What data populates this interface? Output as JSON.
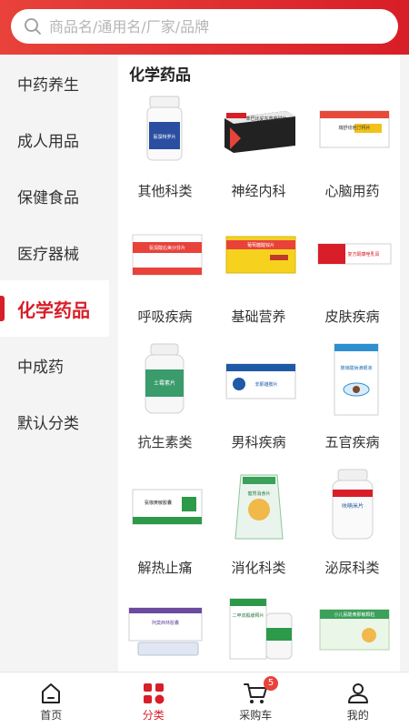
{
  "search": {
    "placeholder": "商品名/通用名/厂家/品牌"
  },
  "sidebar": {
    "items": [
      {
        "label": "中药养生"
      },
      {
        "label": "成人用品"
      },
      {
        "label": "保健食品"
      },
      {
        "label": "医疗器械"
      },
      {
        "label": "化学药品",
        "active": true
      },
      {
        "label": "中成药"
      },
      {
        "label": "默认分类"
      }
    ]
  },
  "section": {
    "title": "化学药品"
  },
  "categories": [
    {
      "label": "其他科类",
      "icon": "white-pill-bottle-icon"
    },
    {
      "label": "神经内科",
      "icon": "medicine-box-icon"
    },
    {
      "label": "心脑用药",
      "icon": "medicine-box-icon"
    },
    {
      "label": "呼吸疾病",
      "icon": "medicine-box-icon"
    },
    {
      "label": "基础营养",
      "icon": "medicine-box-icon"
    },
    {
      "label": "皮肤疾病",
      "icon": "medicine-box-icon"
    },
    {
      "label": "抗生素类",
      "icon": "pill-bottle-icon"
    },
    {
      "label": "男科疾病",
      "icon": "medicine-box-icon"
    },
    {
      "label": "五官疾病",
      "icon": "eye-drops-box-icon"
    },
    {
      "label": "解热止痛",
      "icon": "medicine-box-icon"
    },
    {
      "label": "消化科类",
      "icon": "medicine-pouch-icon"
    },
    {
      "label": "泌尿科类",
      "icon": "pill-bottle-icon"
    },
    {
      "label": "",
      "icon": "medicine-box-icon"
    },
    {
      "label": "",
      "icon": "medicine-box-icon"
    },
    {
      "label": "",
      "icon": "medicine-box-icon"
    }
  ],
  "thumb_text": {
    "t1": "氨溴特罗片",
    "t2": "苯巴比妥东莨菪碱片",
    "t3": "瑞舒伐他汀钙片",
    "t4": "氨溴酸右美沙芬片",
    "t5": "葡萄糖酸锌片",
    "t6": "复方酮康唑乳膏",
    "t7": "土霉素片",
    "t8": "非那雄胺片",
    "t9": "玻璃酸钠滴眼液",
    "t10": "氨咖黄敏胶囊",
    "t11": "健胃消食片",
    "t12": "呋喃米片",
    "t13": "阿莫西林胶囊",
    "t14": "二甲双胍缓释片",
    "t15": "小儿氨酚黄那敏颗粒"
  },
  "tabbar": {
    "items": [
      {
        "label": "首页",
        "icon": "home-icon"
      },
      {
        "label": "分类",
        "icon": "category-grid-icon",
        "active": true
      },
      {
        "label": "采购车",
        "icon": "cart-icon",
        "badge": "5"
      },
      {
        "label": "我的",
        "icon": "user-icon"
      }
    ]
  },
  "colors": {
    "accent": "#d81e28",
    "header_gradient_start": "#e8423a",
    "background": "#f4f4f4"
  }
}
